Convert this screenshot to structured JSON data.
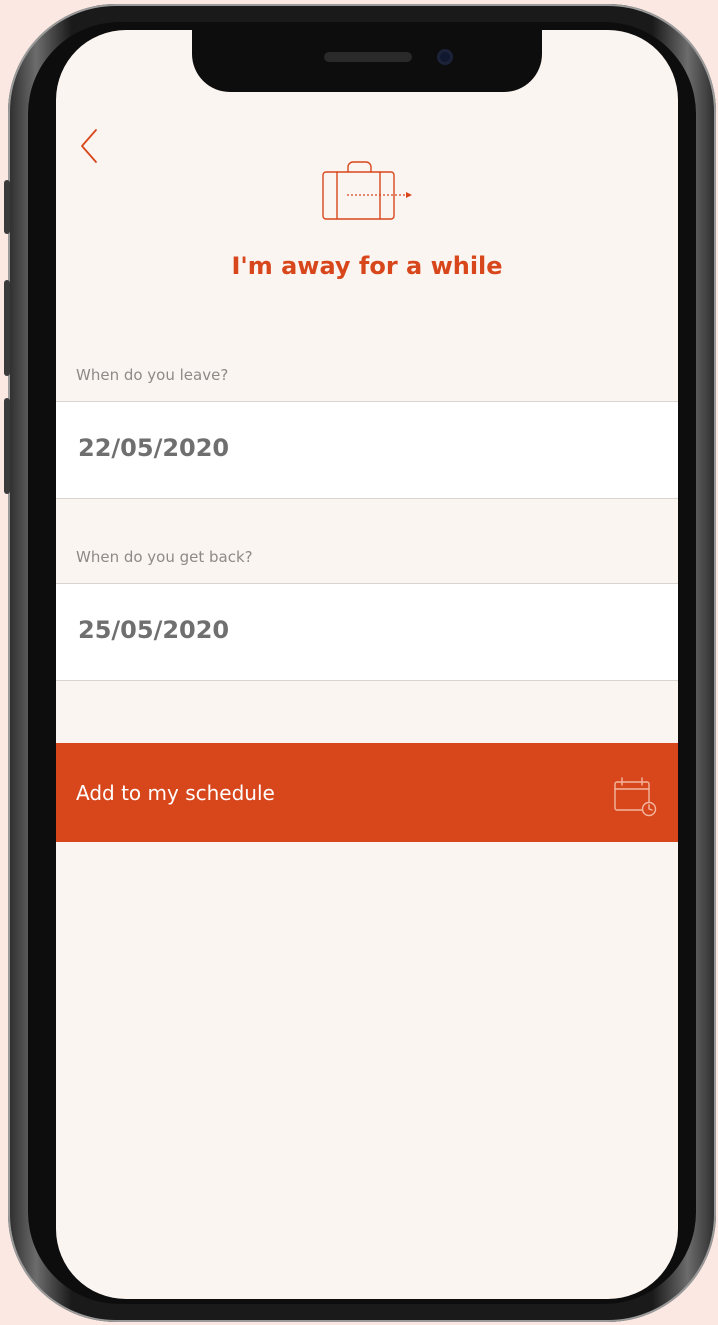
{
  "page": {
    "title": "I'm away for a while",
    "accent_color": "#d8461c",
    "background_color": "#fbf5f1"
  },
  "nav": {
    "back_icon": "chevron-left-icon"
  },
  "header": {
    "icon": "suitcase-icon"
  },
  "leave": {
    "label": "When do you leave?",
    "value": "22/05/2020"
  },
  "return": {
    "label": "When do you get back?",
    "value": "25/05/2020"
  },
  "cta": {
    "label": "Add to my schedule",
    "icon": "calendar-clock-icon"
  }
}
